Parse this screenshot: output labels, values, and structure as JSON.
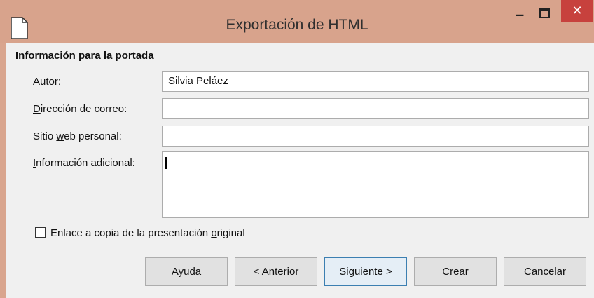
{
  "window": {
    "title": "Exportación de HTML",
    "close_symbol": "✕",
    "minimize_symbol": "–"
  },
  "colors": {
    "titlebar": "#d8a38c",
    "close": "#c7413d",
    "client": "#f0f0f0"
  },
  "section": {
    "title": "Información para la portada"
  },
  "fields": {
    "author": {
      "label_pre": "",
      "label_u": "A",
      "label_post": "utor:",
      "value": "Silvia Peláez"
    },
    "email": {
      "label_pre": "",
      "label_u": "D",
      "label_post": "irección de correo:",
      "value": ""
    },
    "website": {
      "label_pre": "Sitio ",
      "label_u": "w",
      "label_post": "eb personal:",
      "value": ""
    },
    "additional": {
      "label_pre": "",
      "label_u": "I",
      "label_post": "nformación adicional:",
      "value": ""
    }
  },
  "checkbox": {
    "label_pre": "Enlace a copia de la presentación ",
    "label_u": "o",
    "label_post": "riginal",
    "checked": false
  },
  "buttons": {
    "help": {
      "pre": "Ay",
      "u": "u",
      "post": "da"
    },
    "back": {
      "pre": "< Anterior",
      "u": "",
      "post": ""
    },
    "next": {
      "pre": "",
      "u": "S",
      "post": "iguiente >"
    },
    "create": {
      "pre": "",
      "u": "C",
      "post": "rear"
    },
    "cancel": {
      "pre": "",
      "u": "C",
      "post": "ancelar"
    }
  }
}
